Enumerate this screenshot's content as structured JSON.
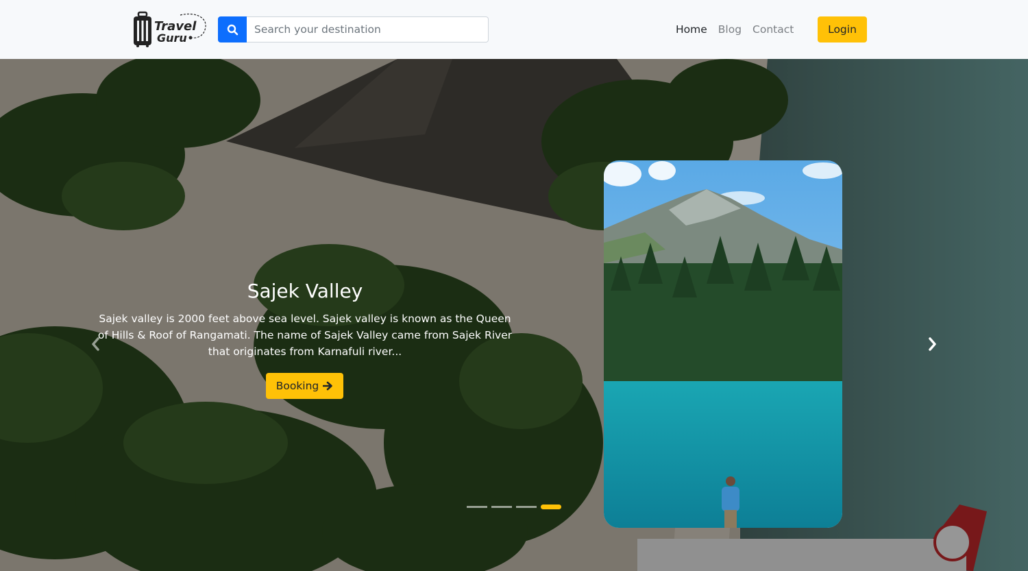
{
  "brand": {
    "logo_line1": "Travel",
    "logo_line2": "Guru"
  },
  "search": {
    "placeholder": "Search your destination",
    "value": "",
    "icon": "search-icon"
  },
  "nav": {
    "items": [
      {
        "label": "Home",
        "active": true
      },
      {
        "label": "Blog",
        "active": false
      },
      {
        "label": "Contact",
        "active": false
      }
    ],
    "login_label": "Login"
  },
  "hero": {
    "title": "Sajek Valley",
    "description": "Sajek valley is 2000 feet above sea level. Sajek valley is known as the Queen of Hills & Roof of Rangamati. The name of Sajek Valley came from Sajek River that originates from Karnafuli river...",
    "booking_label": "Booking",
    "booking_icon": "arrow-right-icon",
    "prev_icon": "chevron-left-icon",
    "next_icon": "chevron-right-icon",
    "slide_count": 4,
    "active_slide": 4
  },
  "colors": {
    "accent": "#ffc107",
    "search_button": "#0d6efd",
    "navbar_bg": "#f7f9fb",
    "nav_active": "#212529",
    "nav_inactive": "#7b7f84"
  }
}
